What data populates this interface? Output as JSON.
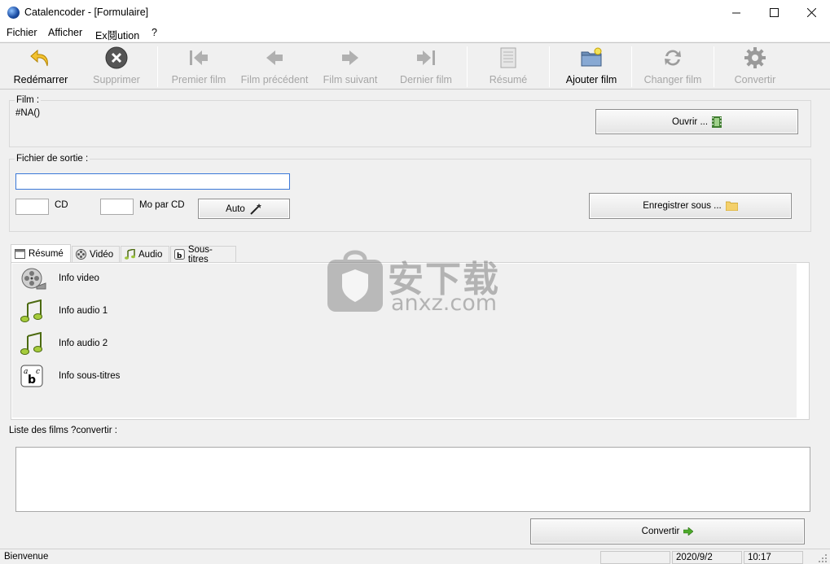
{
  "window": {
    "app_name": "Catalencoder",
    "doc_title": "Catalencoder - [Formulaire]"
  },
  "menu": [
    "Fichier",
    "Afficher",
    "Ex鬩ution",
    "?"
  ],
  "toolbar": {
    "restart": "Redémarrer",
    "delete": "Supprimer",
    "first": "Premier film",
    "prev": "Film précédent",
    "next": "Film suivant",
    "last": "Dernier film",
    "summary": "Résumé",
    "add": "Ajouter film",
    "change": "Changer film",
    "convert": "Convertir"
  },
  "film": {
    "label": "Film :",
    "value": "#NA()",
    "open_button": "Ouvrir ..."
  },
  "output": {
    "label": "Fichier de sortie :",
    "path_value": "",
    "cd_value": "",
    "cd_label": "CD",
    "mo_value": "",
    "mo_label": "Mo par CD",
    "auto_button": "Auto",
    "save_as_button": "Enregistrer sous ..."
  },
  "tabs": [
    "Résumé",
    "Vidéo",
    "Audio",
    "Sous-titres"
  ],
  "summary_items": [
    "Info video",
    "Info audio 1",
    "Info audio 2",
    "Info sous-titres"
  ],
  "list": {
    "label": "Liste des films ?convertir :"
  },
  "convert_button": "Convertir",
  "status": {
    "message": "Bienvenue",
    "date": "2020/9/2",
    "time": "10:17"
  },
  "watermark": {
    "cn": "安下载",
    "site": "anxz.com"
  }
}
